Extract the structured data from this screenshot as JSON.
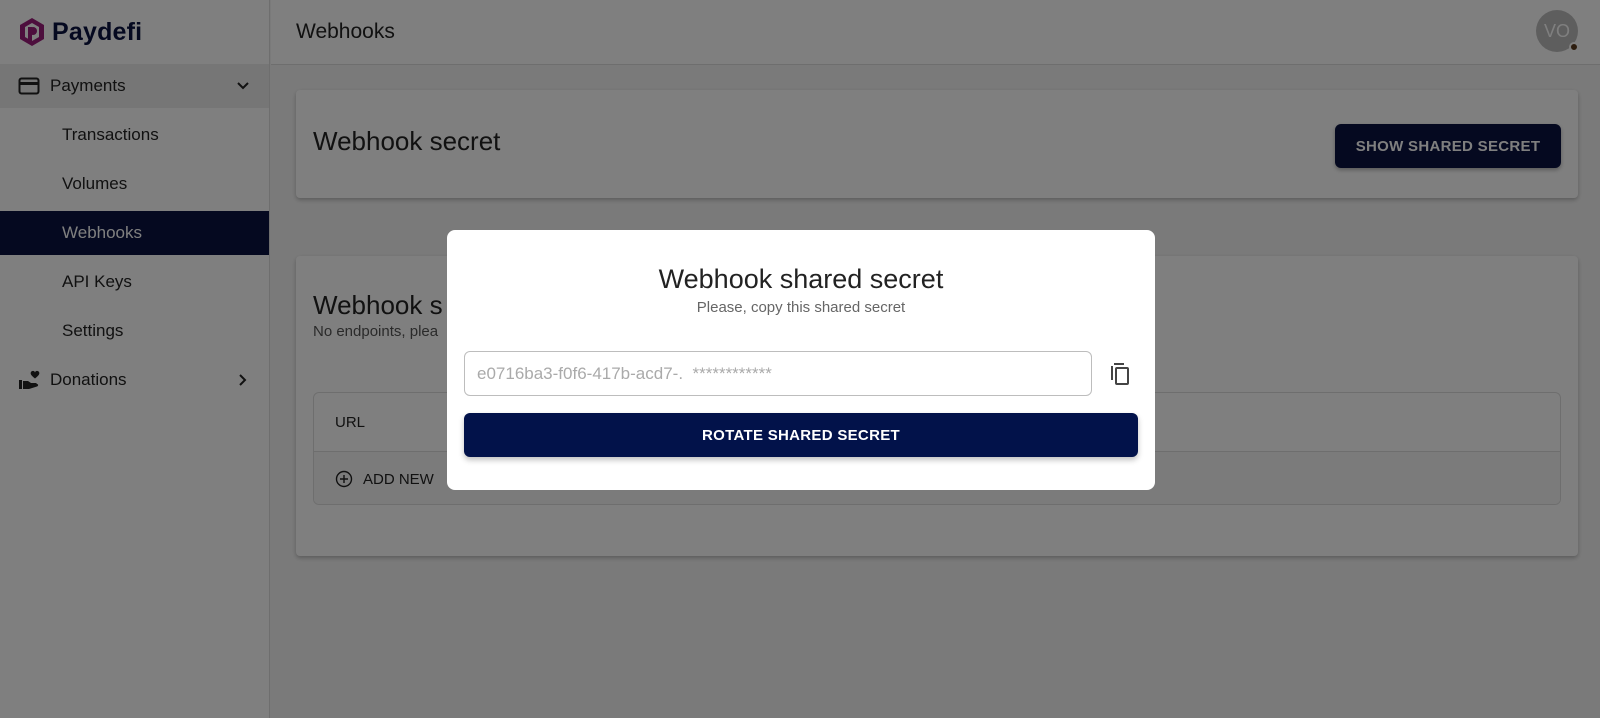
{
  "app": {
    "brand": "Paydefi",
    "colors": {
      "primary": "#0a1240",
      "brand_accent": "#9b1d7a",
      "active_bg": "#0a1240"
    }
  },
  "sidebar": {
    "groups": [
      {
        "label": "Payments",
        "icon": "credit-card-icon",
        "expanded": true,
        "items": [
          {
            "label": "Transactions",
            "active": false
          },
          {
            "label": "Volumes",
            "active": false
          },
          {
            "label": "Webhooks",
            "active": true
          },
          {
            "label": "API Keys",
            "active": false
          },
          {
            "label": "Settings",
            "active": false
          }
        ]
      },
      {
        "label": "Donations",
        "icon": "hand-heart-icon",
        "expanded": false,
        "items": []
      }
    ]
  },
  "header": {
    "title": "Webhooks",
    "avatar_initials": "VO"
  },
  "main": {
    "secret_card": {
      "title": "Webhook secret",
      "show_button": "SHOW SHARED SECRET"
    },
    "endpoints_card": {
      "title": "Webhook s",
      "subtitle": "No endpoints, plea",
      "table_headers": [
        "URL"
      ],
      "add_new_label": "ADD NEW"
    }
  },
  "modal": {
    "title": "Webhook shared secret",
    "subtitle": "Please, copy this shared secret",
    "secret_value": "e0716ba3-f0f6-417b-acd7-.  ************",
    "copy_icon": "copy-icon",
    "rotate_button": "ROTATE SHARED SECRET"
  }
}
